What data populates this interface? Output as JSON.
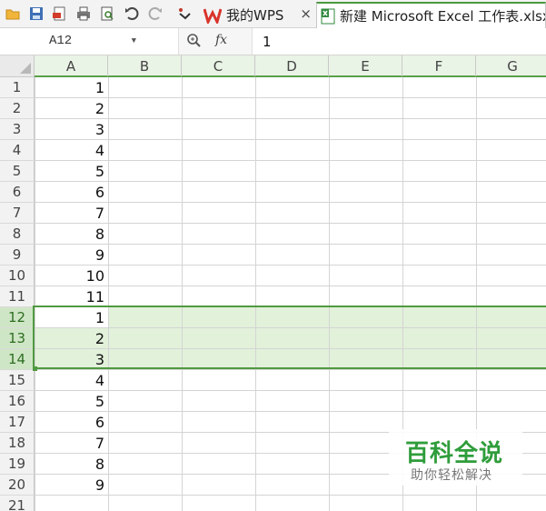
{
  "toolbar": {
    "icons": [
      "open-folder-icon",
      "save-icon",
      "export-pdf-icon",
      "print-icon",
      "print-preview-icon",
      "undo-icon",
      "redo-icon",
      "customize-toolbar-icon"
    ],
    "tabs": [
      {
        "label": "我的WPS",
        "close": "×",
        "icon": "wps-logo-icon"
      },
      {
        "label": "新建 Microsoft Excel 工作表.xlsx",
        "icon": "excel-file-icon"
      }
    ]
  },
  "formula_bar": {
    "name_box": "A12",
    "zoom_icon": "zoom-icon",
    "fx_label": "fx",
    "value": "1"
  },
  "sheet": {
    "columns": [
      "A",
      "B",
      "C",
      "D",
      "E",
      "F",
      "G"
    ],
    "rows": [
      "1",
      "2",
      "3",
      "4",
      "5",
      "6",
      "7",
      "8",
      "9",
      "10",
      "11",
      "12",
      "13",
      "14",
      "15",
      "16",
      "17",
      "18",
      "19",
      "20",
      "21"
    ],
    "column_a": [
      "1",
      "2",
      "3",
      "4",
      "5",
      "6",
      "7",
      "8",
      "9",
      "10",
      "11",
      "1",
      "2",
      "3",
      "4",
      "5",
      "6",
      "7",
      "8",
      "9",
      ""
    ],
    "selection": "A12:G14",
    "selected_rows": [
      "12",
      "13",
      "14"
    ],
    "active_cell": "A12",
    "selection_color": "#e2f1da",
    "accent_color": "#4f9a40"
  },
  "watermark": {
    "title": "百科全说",
    "subtitle": "助你轻松解决"
  }
}
